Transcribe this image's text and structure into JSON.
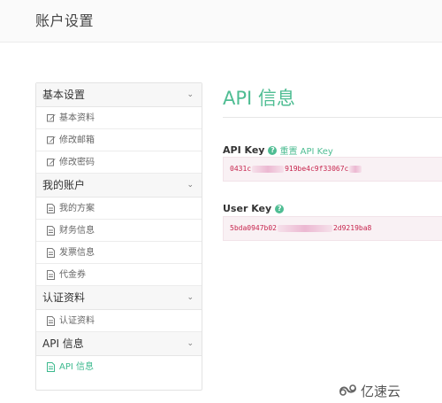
{
  "header": {
    "title": "账户设置"
  },
  "sidebar": {
    "groups": [
      {
        "title": "基本设置",
        "chevron_icon": "chevron-down-icon",
        "items": [
          {
            "label": "基本资料",
            "icon": "edit-icon"
          },
          {
            "label": "修改邮箱",
            "icon": "edit-icon"
          },
          {
            "label": "修改密码",
            "icon": "edit-icon"
          }
        ]
      },
      {
        "title": "我的账户",
        "chevron_icon": "chevron-down-icon",
        "items": [
          {
            "label": "我的方案",
            "icon": "document-icon"
          },
          {
            "label": "财务信息",
            "icon": "document-icon"
          },
          {
            "label": "发票信息",
            "icon": "document-icon"
          },
          {
            "label": "代金券",
            "icon": "document-icon"
          }
        ]
      },
      {
        "title": "认证资料",
        "chevron_icon": "chevron-down-icon",
        "items": [
          {
            "label": "认证资料",
            "icon": "document-icon"
          }
        ]
      },
      {
        "title": "API 信息",
        "chevron_icon": "chevron-down-icon",
        "items": [
          {
            "label": "API 信息",
            "icon": "document-icon",
            "active": true
          }
        ]
      }
    ]
  },
  "main": {
    "title": "API 信息",
    "api_key": {
      "label": "API Key",
      "help_icon": "question-circle-icon",
      "reset_label": "重置 API Key",
      "value_prefix": "0431c",
      "value_middle": "919be4c9f33067c",
      "value_suffix": ""
    },
    "user_key": {
      "label": "User Key",
      "help_icon": "question-circle-icon",
      "value_prefix": "5bda0947b02",
      "value_suffix": "2d9219ba8"
    }
  },
  "watermark": {
    "text": "亿速云",
    "logo_icon": "yisu-cloud-logo"
  },
  "colors": {
    "accent": "#4fbd93",
    "code_text": "#c7254e",
    "code_bg": "#f9f1f4"
  }
}
